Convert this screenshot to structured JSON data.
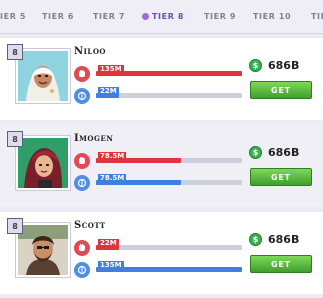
{
  "tabs": [
    {
      "label": "TIER 5"
    },
    {
      "label": "TIER 6"
    },
    {
      "label": "TIER 7"
    },
    {
      "label": "TIER 8",
      "active": true
    },
    {
      "label": "TIER 9"
    },
    {
      "label": "TIER 10"
    },
    {
      "label": "TIER"
    }
  ],
  "cards": [
    {
      "level": "8",
      "name": "Niloo",
      "red_label": "135M",
      "red_fill": 1.0,
      "blue_label": "22M",
      "blue_fill": 0.16,
      "price": "686B",
      "button": "GET"
    },
    {
      "level": "8",
      "name": "Imogen",
      "red_label": "78.5M",
      "red_fill": 0.58,
      "blue_label": "78.5M",
      "blue_fill": 0.58,
      "price": "686B",
      "button": "GET"
    },
    {
      "level": "8",
      "name": "Scott",
      "red_label": "22M",
      "red_fill": 0.16,
      "blue_label": "135M",
      "blue_fill": 1.0,
      "price": "686B",
      "button": "GET"
    }
  ],
  "colors": {
    "accent": "#6a4fb4",
    "get_button": "#4cae3a",
    "red_stat": "#e0343c",
    "blue_stat": "#3f7fe0"
  },
  "icons": {
    "red_stat": "fist-icon",
    "blue_stat": "brain-icon",
    "currency": "coin-icon"
  }
}
